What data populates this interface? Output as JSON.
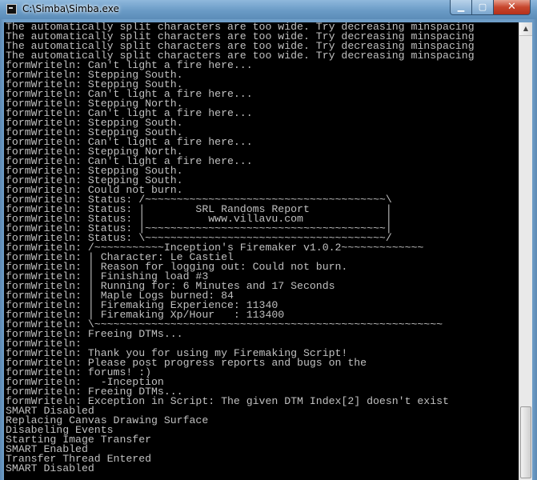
{
  "window": {
    "title": "C:\\Simba\\Simba.exe",
    "icon": "console-app-icon",
    "controls": {
      "minimize": "▁",
      "maximize": "▢",
      "close": "✕"
    }
  },
  "colors": {
    "console_background": "#000000",
    "console_text": "#c0c0c0",
    "titlebar": "#6a9bc6",
    "close_button": "#c7452c"
  },
  "scrollbar": {
    "up_arrow": "▲"
  },
  "console": {
    "text": "The automatically split characters are too wide. Try decreasing minspacing\nThe automatically split characters are too wide. Try decreasing minspacing\nThe automatically split characters are too wide. Try decreasing minspacing\nThe automatically split characters are too wide. Try decreasing minspacing\nformWriteln: Can't light a fire here...\nformWriteln: Stepping South.\nformWriteln: Stepping South.\nformWriteln: Can't light a fire here...\nformWriteln: Stepping North.\nformWriteln: Can't light a fire here...\nformWriteln: Stepping South.\nformWriteln: Stepping South.\nformWriteln: Can't light a fire here...\nformWriteln: Stepping North.\nformWriteln: Can't light a fire here...\nformWriteln: Stepping South.\nformWriteln: Stepping South.\nformWriteln: Could not burn.\nformWriteln: Status: /~~~~~~~~~~~~~~~~~~~~~~~~~~~~~~~~~~~~~~\\\nformWriteln: Status: |        SRL Randoms Report            |\nformWriteln: Status: |          www.villavu.com             |\nformWriteln: Status: |~~~~~~~~~~~~~~~~~~~~~~~~~~~~~~~~~~~~~~|\nformWriteln: Status: \\~~~~~~~~~~~~~~~~~~~~~~~~~~~~~~~~~~~~~~/\nformWriteln: /~~~~~~~~~~~Inception's Firemaker v1.0.2~~~~~~~~~~~~~\nformWriteln: | Character: Le Castiel\nformWriteln: | Reason for logging out: Could not burn.\nformWriteln: | Finishing load #3\nformWriteln: | Running for: 6 Minutes and 17 Seconds\nformWriteln: | Maple Logs burned: 84\nformWriteln: | Firemaking Experience: 11340\nformWriteln: | Firemaking Xp/Hour   : 113400\nformWriteln: \\~~~~~~~~~~~~~~~~~~~~~~~~~~~~~~~~~~~~~~~~~~~~~~~~~~~~~~~\nformWriteln: Freeing DTMs...\nformWriteln:\nformWriteln: Thank you for using my Firemaking Script!\nformWriteln: Please post progress reports and bugs on the\nformWriteln: forums! :)\nformWriteln:   -Inception\nformWriteln: Freeing DTMs...\nformWriteln: Exception in Script: The given DTM Index[2] doesn't exist\nSMART Disabled\nReplacing Canvas Drawing Surface\nDisabeling Events\nStarting Image Transfer\nSMART Enabled\nTransfer Thread Entered\nSMART Disabled"
  }
}
